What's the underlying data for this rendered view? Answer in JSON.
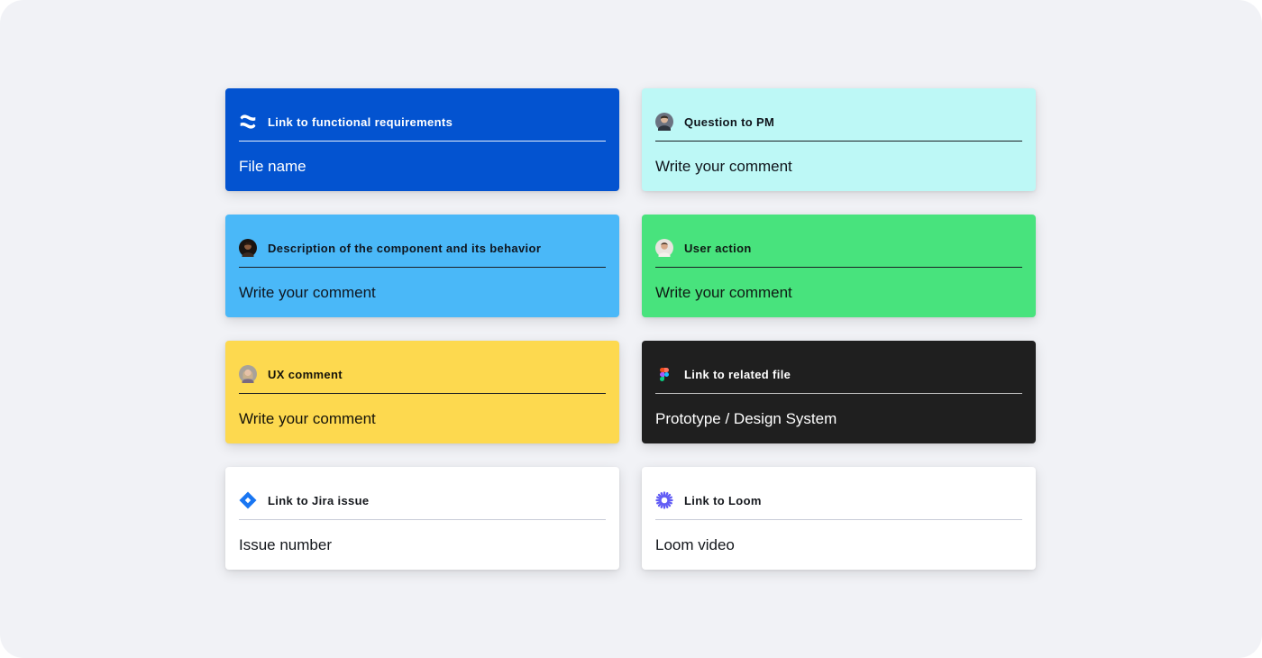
{
  "colors": {
    "background": "#f1f2f6",
    "confluence_blue": "#0353d0",
    "cyan": "#bdf8f6",
    "sky_blue": "#4ab8f8",
    "green": "#48e37d",
    "yellow": "#fdd94f",
    "dark": "#1f1f1f",
    "white": "#ffffff",
    "jira_blue": "#1976f2",
    "loom_purple": "#625df5"
  },
  "cards": [
    {
      "title": "Link to functional requirements",
      "value": "File name",
      "icon": "confluence-icon",
      "background": "#0353d0"
    },
    {
      "title": "Question to PM",
      "value": "Write your comment",
      "icon": "avatar-pm",
      "background": "#bdf8f6"
    },
    {
      "title": "Description of the component and its behavior",
      "value": "Write your comment",
      "icon": "avatar-author",
      "background": "#4ab8f8"
    },
    {
      "title": "User action",
      "value": "Write your comment",
      "icon": "avatar-user",
      "background": "#48e37d"
    },
    {
      "title": "UX comment",
      "value": "Write your comment",
      "icon": "avatar-ux",
      "background": "#fdd94f"
    },
    {
      "title": "Link to related file",
      "value": "Prototype / Design System",
      "icon": "figma-icon",
      "background": "#1f1f1f"
    },
    {
      "title": "Link to Jira issue",
      "value": "Issue number",
      "icon": "jira-icon",
      "background": "#ffffff"
    },
    {
      "title": "Link to Loom",
      "value": "Loom video",
      "icon": "loom-icon",
      "background": "#ffffff"
    }
  ]
}
